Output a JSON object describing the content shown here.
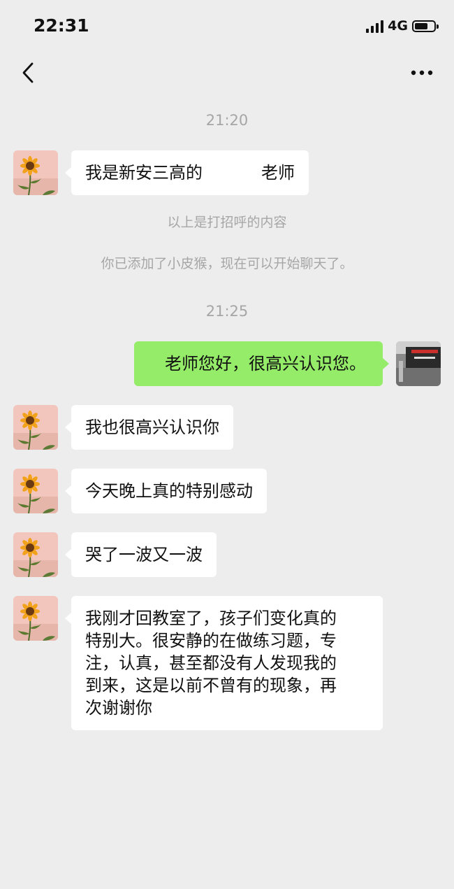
{
  "status": {
    "time": "22:31",
    "network": "4G",
    "battery_level": 0.7
  },
  "nav": {
    "back_icon": "chevron-left-icon",
    "more_icon": "more-dots-icon"
  },
  "chat": {
    "timestamps": [
      "21:20",
      "21:25"
    ],
    "system_messages": [
      "以上是打招呼的内容",
      "你已添加了小皮猴，现在可以开始聊天了。"
    ],
    "messages": [
      {
        "from": "other",
        "text_before": "我是新安三高的",
        "text_after": "老师"
      },
      {
        "from": "me",
        "text": "老师您好，很高兴认识您。"
      },
      {
        "from": "other",
        "text": "我也很高兴认识你"
      },
      {
        "from": "other",
        "text": "今天晚上真的特别感动"
      },
      {
        "from": "other",
        "text": "哭了一波又一波"
      },
      {
        "from": "other",
        "lines": [
          "我刚才回教室了，孩子们变化真的",
          "特别大。很安静的在做练习题，专",
          "注，认真，甚至都没有人发现我的",
          "到来，这是以前不曾有的现象，再",
          "次谢谢你"
        ]
      }
    ]
  },
  "colors": {
    "background": "#ededed",
    "incoming_bubble": "#ffffff",
    "outgoing_bubble": "#95ec69",
    "meta_text": "#a6a6a6"
  }
}
